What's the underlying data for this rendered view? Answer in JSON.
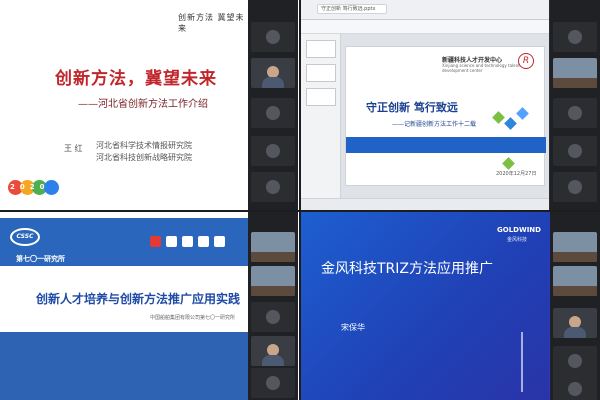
{
  "top_left": {
    "top_label": "创新方法  冀望未来",
    "title": "创新方法，冀望未来",
    "subtitle": "——河北省创新方法工作介绍",
    "presenter": "王  红",
    "orgs": [
      "河北省科学技术情报研究院",
      "河北省科技创新战略研究院"
    ],
    "logo_text": "2020"
  },
  "top_right": {
    "tab_label": "守正创新 笃行致远.pptx",
    "org_cn": "新疆科技人才开发中心",
    "org_en": "Xinjiang science and technology talent development center",
    "logo_letter": "R",
    "title": "守正创新  笃行致远",
    "subtitle": "——记新疆创新方法工作十二载",
    "date": "2020年12月27日"
  },
  "bottom_left": {
    "logo_text": "CSSC",
    "institute": "第七〇一研究所",
    "title": "创新人才培养与创新方法推广应用实践",
    "company": "中国船舶集团有限公司第七〇一研究所"
  },
  "bottom_right": {
    "logo": "GOLDWIND",
    "logo_cn": "金风科技",
    "title": "金风科技TRIZ方法应用推广",
    "presenter": "宋保华"
  }
}
